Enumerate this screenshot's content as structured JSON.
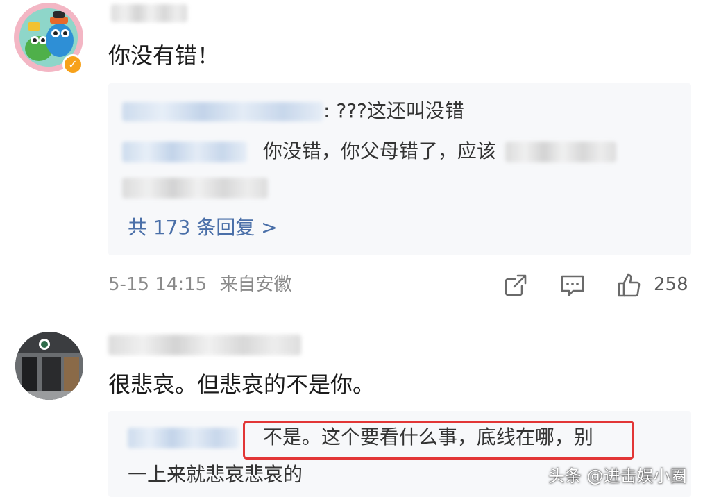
{
  "comment1": {
    "text": "你没有错！",
    "reply_line1_suffix": ": ???这还叫没错",
    "reply_line2_text": "你没错，你父母错了，应该",
    "more_replies": "共 173 条回复 >",
    "time": "5-15 14:15",
    "location": "来自安徽",
    "like_count": "258",
    "icons": [
      "share-icon",
      "comment-icon",
      "like-icon"
    ]
  },
  "comment2": {
    "text": "很悲哀。但悲哀的不是你。",
    "reply_line1": "不是。这个要看什么事，底线在哪，别",
    "reply_line2": "一上来就悲哀悲哀的"
  },
  "watermark": "头条 @进击娱小圈",
  "colors": {
    "link": "#4a6fa8",
    "meta": "#8a8a8a",
    "highlight": "#e23636",
    "verified_badge": "#f7a11a"
  }
}
